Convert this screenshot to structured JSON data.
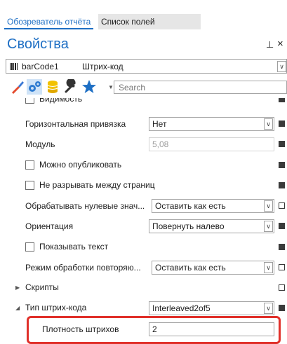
{
  "tabs": [
    {
      "label": "Обозреватель отчёта",
      "active": true
    },
    {
      "label": "Список полей",
      "active": false
    }
  ],
  "panel": {
    "title": "Свойства",
    "pin": "⊥",
    "close": "×"
  },
  "selector": {
    "name": "barCode1",
    "type": "Штрих-код"
  },
  "toolbar": {
    "icons": [
      "brush-icon",
      "settings-gears-icon",
      "database-icon",
      "wrench-icon",
      "star-icon"
    ],
    "search_placeholder": "Search"
  },
  "properties": [
    {
      "kind": "checkbox",
      "label": "Видимость",
      "checked": false,
      "marker": "filled"
    },
    {
      "kind": "select",
      "label": "Горизонтальная привязка",
      "value": "Нет",
      "marker": "filled"
    },
    {
      "kind": "text",
      "label": "Модуль",
      "value": "5,08",
      "disabled": true,
      "marker": "filled"
    },
    {
      "kind": "checkbox",
      "label": "Можно опубликовать",
      "checked": false,
      "marker": "filled"
    },
    {
      "kind": "checkbox",
      "label": "Не разрывать между страниц",
      "checked": false,
      "marker": "filled"
    },
    {
      "kind": "select",
      "label": "Обрабатывать нулевые знач...",
      "value": "Оставить как есть",
      "marker": "hollow"
    },
    {
      "kind": "select",
      "label": "Ориентация",
      "value": "Повернуть налево",
      "marker": "filled"
    },
    {
      "kind": "checkbox",
      "label": "Показывать текст",
      "checked": false,
      "marker": "filled"
    },
    {
      "kind": "select",
      "label": "Режим обработки повторяю...",
      "value": "Оставить как есть",
      "marker": "hollow"
    },
    {
      "kind": "section",
      "label": "Скрипты",
      "expanded": false,
      "marker": "hollow"
    },
    {
      "kind": "section-select",
      "label": "Тип штрих-кода",
      "value": "Interleaved2of5",
      "expanded": true,
      "marker": "filled"
    },
    {
      "kind": "child-text",
      "label": "Плотность штрихов",
      "value": "2"
    }
  ],
  "colors": {
    "accent": "#1e6fc4",
    "highlight": "#e0302a"
  }
}
